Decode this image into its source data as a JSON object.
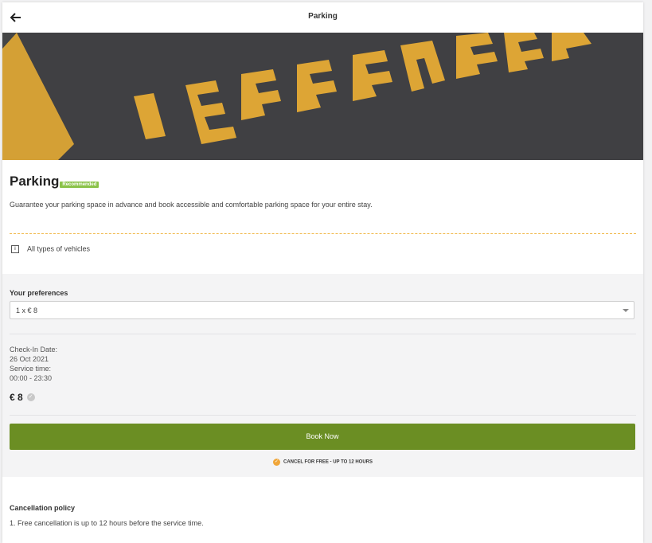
{
  "header": {
    "title": "Parking",
    "back_icon": "arrow-left-icon"
  },
  "hero": {
    "painted_text": "RESERVED",
    "asphalt_color": "#4a4b4d",
    "paint_color": "#f0b43a"
  },
  "service": {
    "title": "Parking",
    "badge": "Recommended",
    "description": "Guarantee your parking space in advance and book accessible and comfortable parking space for your entire stay.",
    "info_icon": "info-icon",
    "info_text": "All types of vehicles"
  },
  "preferences": {
    "label": "Your preferences",
    "selected_option": "1 x € 8"
  },
  "details": {
    "checkin_label": "Check-In Date:",
    "checkin_value": "26 Oct 2021",
    "service_time_label": "Service time:",
    "service_time_value": "00:00 - 23:30"
  },
  "price": {
    "value": "€ 8",
    "icon": "check-circle-icon"
  },
  "book": {
    "label": "Book Now",
    "color": "#6b8e23"
  },
  "cancel_note": {
    "text": "CANCEL FOR FREE - UP TO 12 HOURS",
    "icon": "check-circle-icon",
    "color": "#f0a63a"
  },
  "policy": {
    "title": "Cancellation policy",
    "items": [
      "1. Free cancellation is up to 12 hours before the service time."
    ]
  }
}
